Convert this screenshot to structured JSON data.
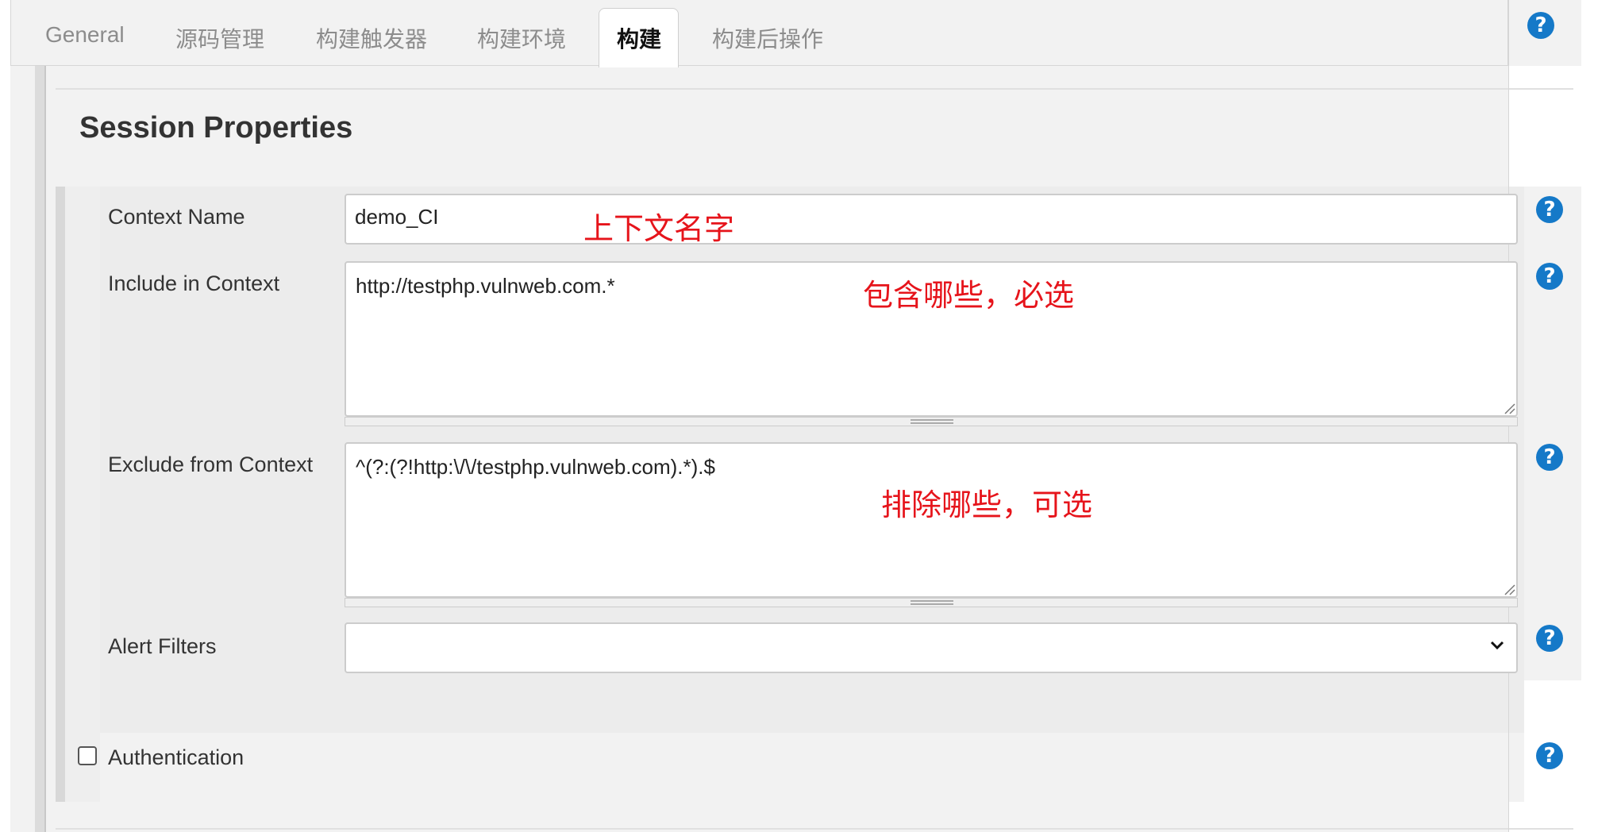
{
  "tabs": [
    {
      "label": "General"
    },
    {
      "label": "源码管理"
    },
    {
      "label": "构建触发器"
    },
    {
      "label": "构建环境"
    },
    {
      "label": "构建"
    },
    {
      "label": "构建后操作"
    }
  ],
  "active_tab": "构建",
  "section": {
    "title": "Session Properties"
  },
  "fields": {
    "context_name": {
      "label": "Context Name",
      "value": "demo_CI",
      "annotation": "上下文名字"
    },
    "include": {
      "label": "Include in Context",
      "value": "http://testphp.vulnweb.com.*",
      "annotation": "包含哪些，必选"
    },
    "exclude": {
      "label": "Exclude from Context",
      "value": "^(?:(?!http:\\/\\/testphp.vulnweb.com).*).$",
      "annotation": "排除哪些，可选"
    },
    "alert_filters": {
      "label": "Alert Filters",
      "value": ""
    }
  },
  "authentication": {
    "label": "Authentication",
    "checked": false
  },
  "help_glyph": "?",
  "icons": {
    "help": "help-icon",
    "dropdown": "chevron-down-icon",
    "resize": "resize-grip-icon"
  },
  "colors": {
    "help": "#1579c8",
    "annotation": "#e6141b",
    "panel": "#f2f2f2"
  }
}
